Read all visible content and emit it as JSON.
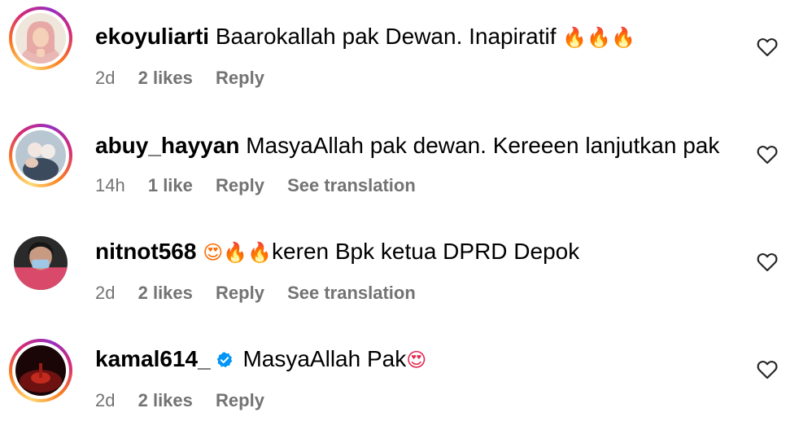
{
  "colors": {
    "text": "#000000",
    "secondary": "#737373",
    "verified": "#0095f6",
    "fire": "#ff6a00",
    "heart_eyes_face": "#ffcc33",
    "heart_eyes_hearts": "#e2264d"
  },
  "comments": [
    {
      "username": "ekoyuliarti",
      "text": " Baarokallah pak Dewan. Inapiratif ",
      "emoji": "🔥🔥🔥",
      "time": "2d",
      "likes": "2 likes",
      "reply": "Reply",
      "avatar_icon": "avatar-photo-icon",
      "has_story_ring": true
    },
    {
      "username": "abuy_hayyan",
      "text": " MasyaAllah pak dewan. Kereeen lanjutkan pak",
      "time": "14h",
      "likes": "1 like",
      "reply": "Reply",
      "translation": "See translation",
      "avatar_icon": "avatar-photo-icon",
      "has_story_ring": true
    },
    {
      "username": "nitnot568",
      "emoji": "😍🔥🔥",
      "text": "keren Bpk ketua DPRD Depok",
      "time": "2d",
      "likes": "2 likes",
      "reply": "Reply",
      "translation": "See translation",
      "avatar_icon": "avatar-photo-icon",
      "has_story_ring": false
    },
    {
      "username": "kamal614_",
      "verified_icon": "verified-badge-icon",
      "text": " MasyaAllah Pak",
      "emoji": "😍",
      "time": "2d",
      "likes": "2 likes",
      "reply": "Reply",
      "avatar_icon": "avatar-photo-icon",
      "has_story_ring": true
    }
  ],
  "like_icon": "heart-outline-icon"
}
